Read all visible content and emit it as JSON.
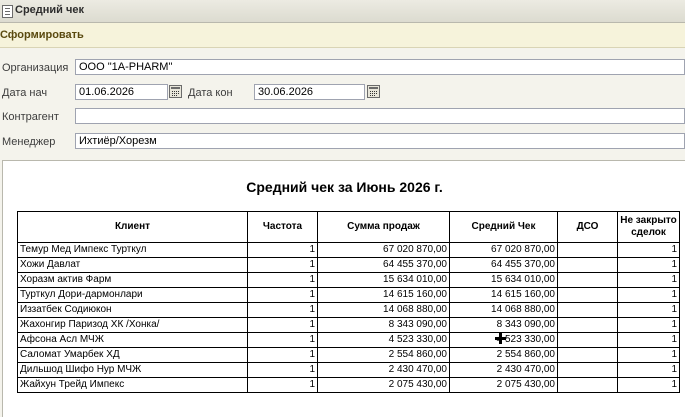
{
  "window": {
    "title": "Средний чек"
  },
  "toolbar": {
    "generate_label": "Сформировать"
  },
  "form": {
    "org_label": "Организация",
    "org_value": "ООО \"1A-PHARM\"",
    "date_start_label": "Дата нач",
    "date_start_value": "01.06.2026",
    "date_end_label": "Дата кон",
    "date_end_value": "30.06.2026",
    "contractor_label": "Контрагент",
    "contractor_value": "",
    "manager_label": "Менеджер",
    "manager_value": "Ихтиёр/Хорезм"
  },
  "report": {
    "title": "Средний чек за Июнь 2026 г.",
    "headers": [
      "Клиент",
      "Частота",
      "Сумма продаж",
      "Средний Чек",
      "ДСО",
      "Не закрыто сделок"
    ],
    "rows": [
      [
        "Темур Мед  Импекс Турткул",
        "1",
        "67 020 870,00",
        "67 020 870,00",
        "",
        "1"
      ],
      [
        "Хожи Давлат",
        "1",
        "64 455 370,00",
        "64 455 370,00",
        "",
        "1"
      ],
      [
        "Хоразм актив Фарм",
        "1",
        "15 634 010,00",
        "15 634 010,00",
        "",
        "1"
      ],
      [
        "Турткул Дори-дармонлари",
        "1",
        "14 615 160,00",
        "14 615 160,00",
        "",
        "1"
      ],
      [
        "Иззатбек Содиюкон",
        "1",
        "14 068 880,00",
        "14 068 880,00",
        "",
        "1"
      ],
      [
        "Жахонгир Паризод ХК /Хонка/",
        "1",
        "8 343 090,00",
        "8 343 090,00",
        "",
        "1"
      ],
      [
        "Афсона Асл МЧЖ",
        "1",
        "4 523 330,00",
        "4 523 330,00",
        "",
        "1"
      ],
      [
        "Саломат Умарбек ХД",
        "1",
        "2 554 860,00",
        "2 554 860,00",
        "",
        "1"
      ],
      [
        "Дильшод Шифо Нур МЧЖ",
        "1",
        "2 430 470,00",
        "2 430 470,00",
        "",
        "1"
      ],
      [
        "Жайхун Трейд Импекс",
        "1",
        "2 075 430,00",
        "2 075 430,00",
        "",
        "1"
      ]
    ]
  }
}
